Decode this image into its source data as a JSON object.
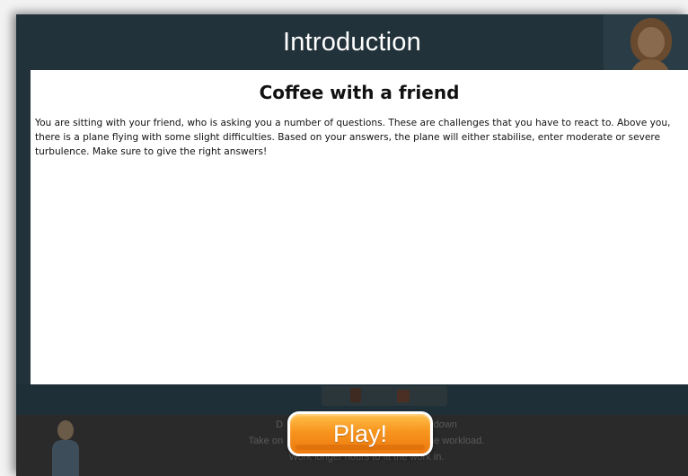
{
  "window": {
    "title": "Introduction"
  },
  "content": {
    "heading": "Coffee with a friend",
    "body": "You are sitting with your friend, who is asking you a number of questions. These are challenges that you have to react to. Above you, there is a plane flying with some slight difficulties. Based on your answers, the plane will either stabilise, enter moderate or severe turbulence. Make sure to give the right answers!"
  },
  "background_options": [
    "D                                                    s down",
    "Take on                                                    the workload.",
    "Work longer hours to fit the work in."
  ],
  "play_button": {
    "label": "Play!"
  },
  "colors": {
    "header_bg": "#22323a",
    "panel_bg": "#ffffff",
    "button_orange": "#f7941d",
    "bottom_bar": "#2a2a2a"
  }
}
